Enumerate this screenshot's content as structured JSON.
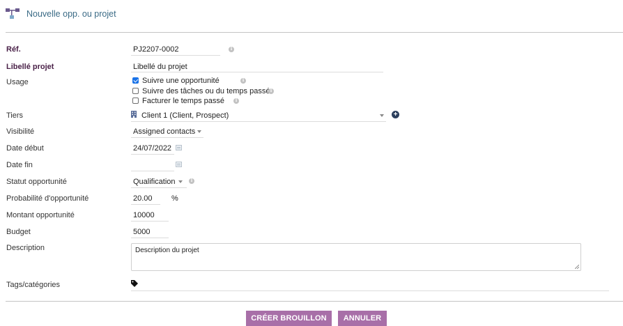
{
  "page": {
    "title": "Nouvelle opp. ou projet"
  },
  "fields": {
    "ref": {
      "label": "Réf.",
      "value": "PJ2207-0002"
    },
    "libelle": {
      "label": "Libellé projet",
      "value": "Libellé du projet"
    },
    "usage": {
      "label": "Usage",
      "options": [
        {
          "label": "Suivre une opportunité",
          "checked": true
        },
        {
          "label": "Suivre des tâches ou du temps passé",
          "checked": false
        },
        {
          "label": "Facturer le temps passé",
          "checked": false
        }
      ]
    },
    "tiers": {
      "label": "Tiers",
      "value": "Client 1 (Client, Prospect)"
    },
    "visibilite": {
      "label": "Visibilité",
      "value": "Assigned contacts"
    },
    "date_debut": {
      "label": "Date début",
      "value": "24/07/2022"
    },
    "date_fin": {
      "label": "Date fin",
      "value": ""
    },
    "statut": {
      "label": "Statut opportunité",
      "value": "Qualification"
    },
    "probabilite": {
      "label": "Probabilité d'opportunité",
      "value": "20.00",
      "unit": "%"
    },
    "montant": {
      "label": "Montant opportunité",
      "value": "10000"
    },
    "budget": {
      "label": "Budget",
      "value": "5000"
    },
    "description": {
      "label": "Description",
      "value": "Description du projet"
    },
    "tags": {
      "label": "Tags/catégories"
    }
  },
  "buttons": {
    "create_draft": "CRÉER BROUILLON",
    "cancel": "ANNULER"
  },
  "icons": {
    "title": "project-tree-icon",
    "info": "info-icon",
    "building": "building-icon",
    "add": "plus-circle-icon",
    "calendar": "calendar-icon",
    "tag": "tag-icon"
  },
  "colors": {
    "title": "#3b6b86",
    "bold_label": "#4a2148",
    "button": "#a86fa8",
    "checkbox": "#1a73e8"
  }
}
